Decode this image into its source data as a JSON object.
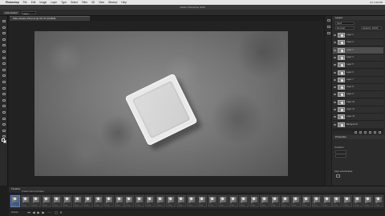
{
  "menubar": {
    "apple": "",
    "items": [
      "Photoshop",
      "File",
      "Edit",
      "Image",
      "Layer",
      "Type",
      "Select",
      "Filter",
      "3D",
      "View",
      "Window",
      "Help"
    ],
    "clock": "Fri 4:15 PM"
  },
  "window": {
    "title": "Adobe Photoshop 2020",
    "doc_tab": "Plate-Rotate-360.psd @ 66.7% (RGB/8)"
  },
  "options": {
    "tool_label": "Auto-Select:",
    "layer_select": "Layer"
  },
  "toolbar": {
    "tools": [
      "move-tool",
      "marquee-tool",
      "lasso-tool",
      "quick-select-tool",
      "crop-tool",
      "eyedropper-tool",
      "healing-tool",
      "brush-tool",
      "clone-tool",
      "history-brush-tool",
      "eraser-tool",
      "gradient-tool",
      "blur-tool",
      "dodge-tool",
      "pen-tool",
      "type-tool",
      "path-select-tool",
      "rectangle-tool",
      "hand-tool",
      "zoom-tool"
    ],
    "foreground_color": "#000000",
    "background_color": "#ffffff"
  },
  "layers": {
    "title": "Layers",
    "kind_filter": "Kind",
    "blend_mode": "Normal",
    "opacity": "Opacity: 100%",
    "rows": [
      {
        "name": "Layer 1",
        "selected": false
      },
      {
        "name": "Layer 2",
        "selected": false
      },
      {
        "name": "Layer 3",
        "selected": true
      },
      {
        "name": "Layer 4",
        "selected": false
      },
      {
        "name": "Layer 5",
        "selected": false
      },
      {
        "name": "Layer 6",
        "selected": false
      },
      {
        "name": "Layer 7",
        "selected": false
      },
      {
        "name": "Layer 8",
        "selected": false
      },
      {
        "name": "Layer 9",
        "selected": false
      },
      {
        "name": "Layer 10",
        "selected": false
      },
      {
        "name": "Layer 11",
        "selected": false
      },
      {
        "name": "Layer 12",
        "selected": false
      },
      {
        "name": "Background",
        "selected": false
      }
    ]
  },
  "properties": {
    "title": "Properties",
    "section1": "Transform",
    "section2": "Align and Distribute",
    "section3": "Quick Actions"
  },
  "timeline": {
    "title": "Timeline",
    "mode_label": "Create Frame Animation",
    "loop": "Forever",
    "frame_delay": "0 sec.",
    "frame_count": 36,
    "selected_frame": 1
  },
  "colors": {
    "panel_bg": "#2b2b2b",
    "selected_blue": "#3c5a86",
    "plate": "#e9e9e9"
  }
}
